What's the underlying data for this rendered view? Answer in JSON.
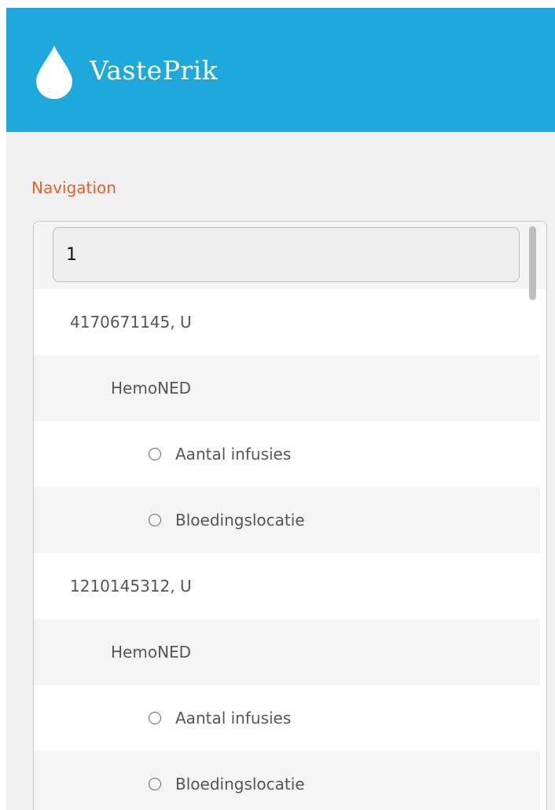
{
  "header": {
    "logo_icon": "water-drop-icon",
    "title": "VastePrik",
    "background_color": "#1fa8dc"
  },
  "navigation": {
    "heading": "Navigation",
    "heading_color": "#e8612c",
    "search": {
      "value": "1",
      "placeholder": ""
    },
    "patients": [
      {
        "label": "4170671145, U",
        "groups": [
          {
            "label": "HemoNED",
            "items": [
              {
                "label": "Aantal infusies",
                "icon": "radio-unchecked-icon"
              },
              {
                "label": "Bloedingslocatie",
                "icon": "radio-unchecked-icon"
              }
            ]
          }
        ]
      },
      {
        "label": "1210145312, U",
        "groups": [
          {
            "label": "HemoNED",
            "items": [
              {
                "label": "Aantal infusies",
                "icon": "radio-unchecked-icon"
              },
              {
                "label": "Bloedingslocatie",
                "icon": "radio-unchecked-icon"
              }
            ]
          }
        ]
      }
    ]
  }
}
